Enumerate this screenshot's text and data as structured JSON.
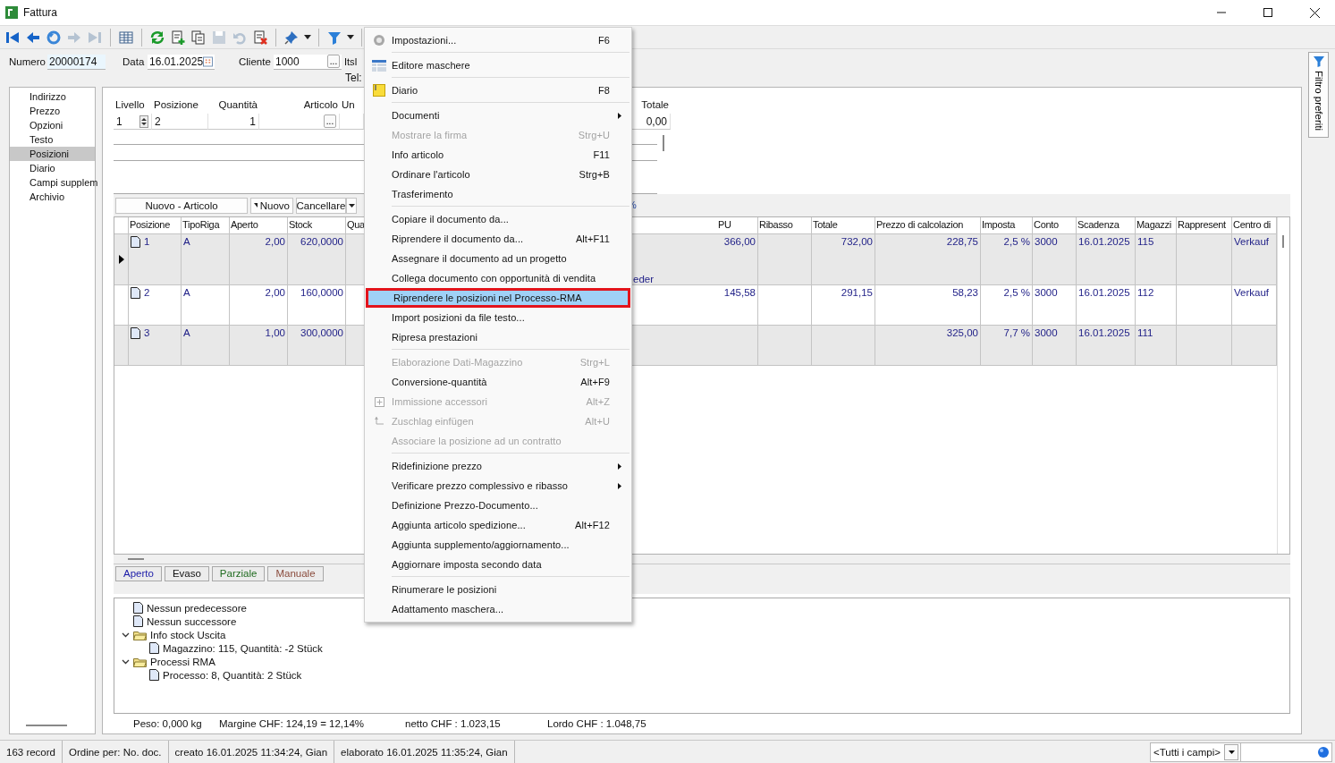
{
  "window": {
    "title": "Fattura"
  },
  "toolbar": [
    {
      "kind": "first",
      "disabled": false
    },
    {
      "kind": "back",
      "disabled": false
    },
    {
      "kind": "circle",
      "disabled": false
    },
    {
      "kind": "forward",
      "disabled": true
    },
    {
      "kind": "last",
      "disabled": true
    },
    {
      "kind": "separator"
    },
    {
      "kind": "grid",
      "disabled": false
    },
    {
      "kind": "separator"
    },
    {
      "kind": "reload",
      "disabled": false
    },
    {
      "kind": "new",
      "disabled": false
    },
    {
      "kind": "copy",
      "disabled": false
    },
    {
      "kind": "save",
      "disabled": true
    },
    {
      "kind": "undo",
      "disabled": true
    },
    {
      "kind": "delete",
      "disabled": false
    },
    {
      "kind": "separator"
    },
    {
      "kind": "pin",
      "disabled": false
    },
    {
      "kind": "dropdown",
      "disabled": false
    },
    {
      "kind": "separator"
    },
    {
      "kind": "filter",
      "disabled": false
    },
    {
      "kind": "dropdown",
      "disabled": false
    },
    {
      "kind": "separator"
    }
  ],
  "header": {
    "number": {
      "label": "Numero",
      "value": "20000174"
    },
    "date": {
      "label": "Data",
      "value": "16.01.2025"
    },
    "customer": {
      "label": "Cliente",
      "value": "1000",
      "button": "..."
    },
    "customer_name": "ItsI",
    "phone_label": "Tel:"
  },
  "nav": [
    {
      "label": "Indirizzo",
      "selected": false
    },
    {
      "label": "Prezzo",
      "selected": false
    },
    {
      "label": "Opzioni",
      "selected": false
    },
    {
      "label": "Testo",
      "selected": false
    },
    {
      "label": "Posizioni",
      "selected": true
    },
    {
      "label": "Diario",
      "selected": false
    },
    {
      "label": "Campi supplem",
      "selected": false
    },
    {
      "label": "Archivio",
      "selected": false
    }
  ],
  "position_form": {
    "fields": [
      {
        "label": "Livello",
        "value": "1",
        "kind": "spin"
      },
      {
        "label": "Posizione",
        "value": "2",
        "kind": "text"
      },
      {
        "label": "Quantità",
        "value": "1",
        "kind": "number"
      },
      {
        "label": "Articolo",
        "kind": "lookup",
        "button": "..."
      },
      {
        "label": "Un",
        "kind": "text"
      }
    ],
    "total": {
      "label": "Totale",
      "value": "0,00"
    }
  },
  "actions": [
    {
      "label": "Nuovo - Articolo",
      "kind": "button"
    },
    {
      "label": "Nuovo",
      "kind": "split"
    },
    {
      "label": "Cancellare",
      "kind": "button"
    },
    {
      "kind": "dropdown"
    }
  ],
  "percent_fragment": "%",
  "table": {
    "columns": [
      "Posizione",
      "TipoRiga",
      "Aperto",
      "Stock",
      "Qua",
      "PU",
      "Ribasso",
      "Totale",
      "Prezzo di calcolazion",
      "Imposta",
      "Conto",
      "Scadenza",
      "Magazzi",
      "Rappresent",
      "Centro di"
    ],
    "rows": [
      {
        "selected": true,
        "cells": {
          "posizione": "1",
          "tipo_riga": "A",
          "aperto": "2,00",
          "stock": "620,0000",
          "column_6": "eder",
          "pu": "366,00",
          "totale": "732,00",
          "prezzo_calcolazione": "228,75",
          "imposta": "2,5 %",
          "conto": "3000",
          "scadenza": "16.01.2025",
          "magazzino": "115",
          "centro": "Verkauf"
        }
      },
      {
        "selected": false,
        "cells": {
          "posizione": "2",
          "tipo_riga": "A",
          "aperto": "2,00",
          "stock": "160,0000",
          "pu": "145,58",
          "totale": "291,15",
          "prezzo_calcolazione": "58,23",
          "imposta": "2,5 %",
          "conto": "3000",
          "scadenza": "16.01.2025",
          "magazzino": "112",
          "centro": "Verkauf"
        }
      },
      {
        "selected": false,
        "cells": {
          "posizione": "3",
          "tipo_riga": "A",
          "aperto": "1,00",
          "stock": "300,0000",
          "prezzo_calcolazione": "325,00",
          "imposta": "7,7 %",
          "conto": "3000",
          "scadenza": "16.01.2025",
          "magazzino": "111"
        }
      }
    ]
  },
  "filters": [
    {
      "label": "Aperto",
      "color": "#1a1aa8"
    },
    {
      "label": "Evaso",
      "color": "#111111"
    },
    {
      "label": "Parziale",
      "color": "#1f6b1f"
    },
    {
      "label": "Manuale",
      "color": "#8a4b3c"
    }
  ],
  "tree": [
    {
      "label": "Nessun predecessore",
      "kind": "document"
    },
    {
      "label": "Nessun successore",
      "kind": "document"
    },
    {
      "label": "Info stock Uscita",
      "kind": "folder",
      "expanded": true,
      "children": [
        {
          "label": "Magazzino: 115, Quantità: -2 Stück",
          "kind": "document"
        }
      ]
    },
    {
      "label": "Processi RMA",
      "kind": "folder",
      "expanded": true,
      "children": [
        {
          "label": "Processo: 8, Quantità: 2 Stück",
          "kind": "document"
        }
      ]
    }
  ],
  "totals": [
    "Peso:  0,000 kg",
    "Margine CHF: 124,19 = 12,14%",
    "netto CHF : 1.023,15",
    "Lordo CHF : 1.048,75"
  ],
  "side_tab": {
    "label": "Filtro preferiti"
  },
  "status_bar": {
    "cells": [
      "163 record",
      "Ordine per: No. doc.",
      "creato 16.01.2025 11:34:24, Gian",
      "elaborato 16.01.2025 11:35:24, Gian"
    ],
    "search_scope": "<Tutti i campi>"
  },
  "menu": {
    "items": [
      {
        "kind": "gear",
        "label": "Impostazioni...",
        "shortcut": "F6",
        "disabled": false,
        "submenu": false,
        "selected": false
      },
      {
        "kind": "separator"
      },
      {
        "kind": "layout",
        "label": "Editore maschere",
        "disabled": false,
        "submenu": false,
        "selected": false
      },
      {
        "kind": "separator"
      },
      {
        "kind": "note",
        "label": "Diario",
        "shortcut": "F8",
        "disabled": false,
        "submenu": false,
        "selected": false
      },
      {
        "kind": "separator"
      },
      {
        "kind": "plain",
        "label": "Documenti",
        "disabled": false,
        "submenu": true,
        "selected": false
      },
      {
        "kind": "plain",
        "label": "Mostrare la firma",
        "shortcut": "Strg+U",
        "disabled": true,
        "submenu": false,
        "selected": false
      },
      {
        "kind": "plain",
        "label": "Info articolo",
        "shortcut": "F11",
        "disabled": false,
        "submenu": false,
        "selected": false
      },
      {
        "kind": "plain",
        "label": "Ordinare l'articolo",
        "shortcut": "Strg+B",
        "disabled": false,
        "submenu": false,
        "selected": false
      },
      {
        "kind": "plain",
        "label": "Trasferimento",
        "disabled": false,
        "submenu": false,
        "selected": false
      },
      {
        "kind": "separator"
      },
      {
        "kind": "plain",
        "label": "Copiare il documento da...",
        "disabled": false,
        "submenu": false,
        "selected": false
      },
      {
        "kind": "plain",
        "label": "Riprendere il documento da...",
        "shortcut": "Alt+F11",
        "disabled": false,
        "submenu": false,
        "selected": false
      },
      {
        "kind": "plain",
        "label": "Assegnare il documento ad un progetto",
        "disabled": false,
        "submenu": false,
        "selected": false
      },
      {
        "kind": "plain",
        "label": "Collega documento con opportunità di vendita",
        "disabled": false,
        "submenu": false,
        "selected": false
      },
      {
        "kind": "plain",
        "label": "Riprendere le posizioni nel Processo-RMA",
        "disabled": false,
        "submenu": false,
        "selected": true
      },
      {
        "kind": "plain",
        "label": "Import posizioni da file testo...",
        "disabled": false,
        "submenu": false,
        "selected": false
      },
      {
        "kind": "plain",
        "label": "Ripresa prestazioni",
        "disabled": false,
        "submenu": false,
        "selected": false
      },
      {
        "kind": "separator"
      },
      {
        "kind": "plain",
        "label": "Elaborazione Dati-Magazzino",
        "shortcut": "Strg+L",
        "disabled": true,
        "submenu": false,
        "selected": false
      },
      {
        "kind": "plain",
        "label": "Conversione-quantità",
        "shortcut": "Alt+F9",
        "disabled": false,
        "submenu": false,
        "selected": false
      },
      {
        "kind": "plus",
        "label": "Immissione accessori",
        "shortcut": "Alt+Z",
        "disabled": true,
        "submenu": false,
        "selected": false
      },
      {
        "kind": "corner",
        "label": "Zuschlag einfügen",
        "shortcut": "Alt+U",
        "disabled": true,
        "submenu": false,
        "selected": false
      },
      {
        "kind": "plain",
        "label": "Associare la posizione ad un contratto",
        "disabled": true,
        "submenu": false,
        "selected": false
      },
      {
        "kind": "separator"
      },
      {
        "kind": "plain",
        "label": "Ridefinizione prezzo",
        "disabled": false,
        "submenu": true,
        "selected": false
      },
      {
        "kind": "plain",
        "label": "Verificare prezzo complessivo e ribasso",
        "disabled": false,
        "submenu": true,
        "selected": false
      },
      {
        "kind": "plain",
        "label": "Definizione Prezzo-Documento...",
        "disabled": false,
        "submenu": false,
        "selected": false
      },
      {
        "kind": "plain",
        "label": "Aggiunta articolo spedizione...",
        "shortcut": "Alt+F12",
        "disabled": false,
        "submenu": false,
        "selected": false
      },
      {
        "kind": "plain",
        "label": "Aggiunta supplemento/aggiornamento...",
        "disabled": false,
        "submenu": false,
        "selected": false
      },
      {
        "kind": "plain",
        "label": "Aggiornare imposta secondo data",
        "disabled": false,
        "submenu": false,
        "selected": false
      },
      {
        "kind": "separator"
      },
      {
        "kind": "plain",
        "label": "Rinumerare le posizioni",
        "disabled": false,
        "submenu": false,
        "selected": false
      },
      {
        "kind": "plain",
        "label": "Adattamento maschera...",
        "disabled": false,
        "submenu": false,
        "selected": false
      }
    ]
  }
}
